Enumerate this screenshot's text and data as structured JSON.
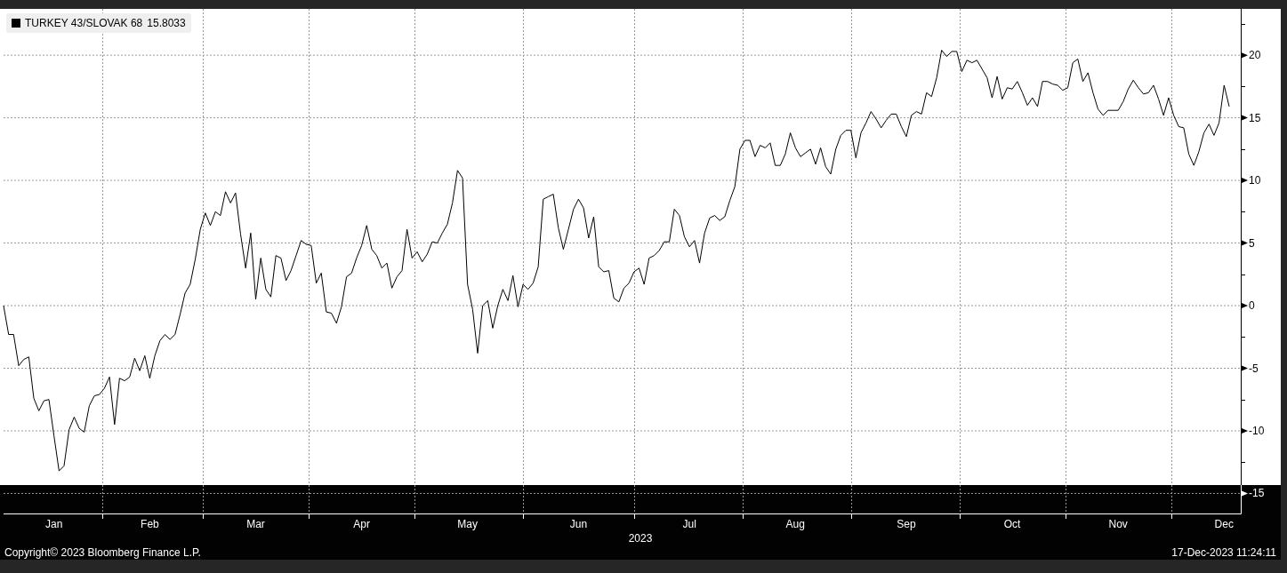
{
  "chart": {
    "legend_value": "15.8033",
    "chart_data": {
      "type": "line",
      "xlabel": "2023",
      "grid": true,
      "ylim": [
        -16.6,
        23.7
      ],
      "yticks": [
        -15,
        -10,
        -5,
        0,
        5,
        10,
        15,
        20
      ],
      "categories": [
        null,
        null,
        null,
        null,
        null,
        null,
        null,
        null,
        null,
        null,
        "Jan",
        null,
        null,
        null,
        null,
        null,
        null,
        null,
        null,
        null,
        null,
        null,
        null,
        null,
        null,
        null,
        null,
        null,
        null,
        "Feb",
        null,
        null,
        null,
        null,
        null,
        null,
        null,
        null,
        null,
        null,
        null,
        null,
        null,
        null,
        null,
        null,
        null,
        null,
        null,
        null,
        "Mar",
        null,
        null,
        null,
        null,
        null,
        null,
        null,
        null,
        null,
        null,
        null,
        null,
        null,
        null,
        null,
        null,
        null,
        null,
        null,
        null,
        "Apr",
        null,
        null,
        null,
        null,
        null,
        null,
        null,
        null,
        null,
        null,
        null,
        null,
        null,
        null,
        null,
        null,
        null,
        null,
        null,
        null,
        "May",
        null,
        null,
        null,
        null,
        null,
        null,
        null,
        null,
        null,
        null,
        null,
        null,
        null,
        null,
        null,
        null,
        null,
        null,
        null,
        null,
        null,
        "Jun",
        null,
        null,
        null,
        null,
        null,
        null,
        null,
        null,
        null,
        null,
        null,
        null,
        null,
        null,
        null,
        null,
        null,
        null,
        null,
        null,
        null,
        "Jul",
        null,
        null,
        null,
        null,
        null,
        null,
        null,
        null,
        null,
        null,
        null,
        null,
        null,
        null,
        null,
        null,
        null,
        null,
        null,
        null,
        "Aug",
        null,
        null,
        null,
        null,
        null,
        null,
        null,
        null,
        null,
        null,
        null,
        null,
        null,
        null,
        null,
        null,
        null,
        null,
        null,
        null,
        null,
        "Sep",
        null,
        null,
        null,
        null,
        null,
        null,
        null,
        null,
        null,
        null,
        null,
        null,
        null,
        null,
        null,
        null,
        null,
        null,
        null,
        null,
        "Oct",
        null,
        null,
        null,
        null,
        null,
        null,
        null,
        null,
        null,
        null,
        null,
        null,
        null,
        null,
        null,
        null,
        null,
        null,
        null,
        null,
        "Nov",
        null,
        null,
        null,
        null,
        null,
        null,
        null,
        null,
        null,
        null,
        null,
        null,
        null,
        null,
        null,
        null,
        null,
        null,
        null,
        null,
        "Dec",
        null
      ],
      "series": [
        {
          "name": "TURKEY 43/SLOVAK 68",
          "color": "#000000",
          "values": [
            0,
            -2.3,
            -2.3,
            -4.8,
            -4.3,
            -4.1,
            -7.4,
            -8.4,
            -7.6,
            -7.5,
            -10.4,
            -13.2,
            -12.8,
            -9.9,
            -8.9,
            -9.8,
            -10.1,
            -8,
            -7.2,
            -7.1,
            -6.6,
            -5.7,
            -9.5,
            -5.8,
            -6,
            -5.7,
            -4.2,
            -5.2,
            -4,
            -5.8,
            -4,
            -2.8,
            -2.3,
            -2.7,
            -2.3,
            -0.7,
            1,
            1.7,
            3.7,
            6.1,
            7.4,
            6.4,
            7.5,
            7.2,
            9.1,
            8.2,
            9,
            5.7,
            3,
            5.8,
            0.5,
            3.8,
            1.3,
            0.7,
            4,
            3.8,
            2,
            2.8,
            4,
            5.2,
            4.9,
            4.8,
            1.8,
            2.6,
            -0.5,
            -0.6,
            -1.4,
            -0.1,
            2.3,
            2.6,
            3.8,
            4.8,
            6.4,
            4.5,
            4,
            3,
            3.4,
            1.4,
            2.3,
            2.8,
            6.1,
            3.8,
            4.3,
            3.5,
            4.1,
            5.1,
            5,
            5.8,
            6.5,
            8.2,
            10.8,
            10.2,
            1.7,
            -0.3,
            -3.8,
            0,
            0.4,
            -1.8,
            0,
            1.3,
            0.4,
            2.4,
            -0.1,
            1.7,
            1.3,
            1.8,
            3.1,
            8.5,
            8.7,
            8.9,
            6.2,
            4.5,
            6.1,
            7.7,
            8.5,
            7.8,
            5.4,
            7.1,
            3.1,
            2.7,
            2.8,
            0.6,
            0.3,
            1.4,
            1.8,
            2.7,
            3,
            1.7,
            3.8,
            4,
            4.4,
            5.1,
            5.1,
            7.7,
            7.2,
            5.5,
            4.7,
            5.2,
            3.4,
            5.8,
            7,
            7.2,
            6.8,
            7.1,
            8.4,
            9.5,
            12.5,
            13.2,
            13.2,
            11.9,
            12.8,
            12.6,
            13,
            11.2,
            11.2,
            12.1,
            13.8,
            12.6,
            11.9,
            12.2,
            12.5,
            11.3,
            12.6,
            11.1,
            10.5,
            12.5,
            13.6,
            14,
            14,
            11.8,
            13.8,
            14.6,
            15.5,
            14.9,
            14.2,
            14.8,
            15.3,
            15.3,
            14.3,
            13.5,
            15.2,
            15.5,
            15.3,
            17,
            16.7,
            18.2,
            20.4,
            19.9,
            20.3,
            20.3,
            18.7,
            19.6,
            19.4,
            19.6,
            18.9,
            18.2,
            16.6,
            18.3,
            16.5,
            17.4,
            17.3,
            17.9,
            17,
            16,
            16.6,
            15.9,
            17.9,
            17.9,
            17.7,
            17.6,
            17.2,
            17.4,
            19.4,
            19.7,
            17.9,
            18.6,
            17,
            15.7,
            15.2,
            15.6,
            15.6,
            15.6,
            16.3,
            17.3,
            18,
            17.4,
            16.9,
            17,
            17.6,
            16.5,
            15.2,
            16.6,
            15.2,
            14.3,
            14.2,
            12.1,
            11.2,
            12.3,
            13.8,
            14.5,
            13.6,
            14.6,
            17.6,
            15.9
          ]
        }
      ]
    }
  },
  "footer": {
    "copyright": "Copyright© 2023 Bloomberg Finance L.P.",
    "timestamp": "17-Dec-2023 11:24:11"
  }
}
